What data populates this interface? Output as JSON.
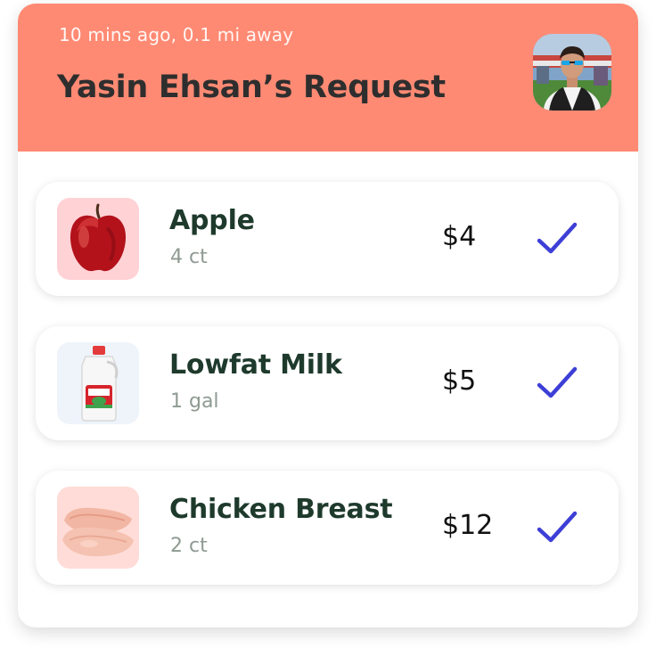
{
  "request": {
    "meta": "10 mins ago, 0.1 mi away",
    "title": "Yasin Ehsan’s Request",
    "avatar_icon": "user-avatar-photo"
  },
  "colors": {
    "header_bg": "#FF8A73",
    "title_text": "#2E2E2E",
    "item_name": "#1E3A2C",
    "item_qty": "#8E9A92",
    "check": "#3D3FD6"
  },
  "items": [
    {
      "name": "Apple",
      "quantity": "4 ct",
      "price": "$4",
      "icon": "apple-image",
      "checked": true
    },
    {
      "name": "Lowfat Milk",
      "quantity": "1 gal",
      "price": "$5",
      "icon": "milk-jug-image",
      "checked": true
    },
    {
      "name": "Chicken Breast",
      "quantity": "2 ct",
      "price": "$12",
      "icon": "chicken-breast-image",
      "checked": true
    }
  ]
}
